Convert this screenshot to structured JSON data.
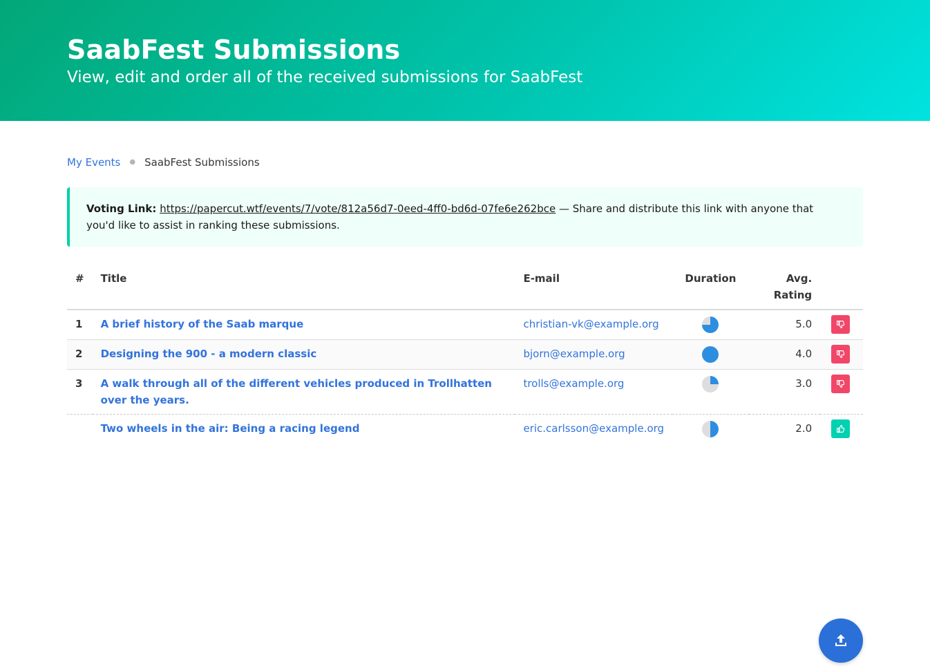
{
  "hero": {
    "title": "SaabFest Submissions",
    "subtitle": "View, edit and order all of the received submissions for SaabFest"
  },
  "breadcrumb": {
    "items": [
      {
        "label": "My Events",
        "link": true
      },
      {
        "label": "SaabFest Submissions",
        "link": false
      }
    ]
  },
  "notice": {
    "prefix": "Voting Link:",
    "url": "https://papercut.wtf/events/7/vote/812a56d7-0eed-4ff0-bd6d-07fe6e262bce",
    "suffix": " — Share and distribute this link with anyone that you'd like to assist in ranking these submissions."
  },
  "table": {
    "headers": {
      "num": "#",
      "title": "Title",
      "email": "E-mail",
      "duration": "Duration",
      "rating": "Avg. Rating"
    },
    "rows": [
      {
        "num": "1",
        "title": "A brief history of the Saab marque",
        "email": "christian-vk@example.org",
        "duration_fraction": 0.75,
        "rating": "5.0",
        "vote": "down"
      },
      {
        "num": "2",
        "title": "Designing the 900 - a modern classic",
        "email": "bjorn@example.org",
        "duration_fraction": 1.0,
        "rating": "4.0",
        "vote": "down"
      },
      {
        "num": "3",
        "title": "A walk through all of the different vehicles produced in Trollhatten over the years.",
        "email": "trolls@example.org",
        "duration_fraction": 0.25,
        "rating": "3.0",
        "vote": "down"
      },
      {
        "num": "",
        "title": "Two wheels in the air: Being a racing legend",
        "email": "eric.carlsson@example.org",
        "duration_fraction": 0.5,
        "rating": "2.0",
        "vote": "up"
      }
    ]
  },
  "icons": {
    "down_vote": "thumbs-down-icon",
    "up_vote": "thumbs-up-icon",
    "upload": "upload-icon"
  },
  "colors": {
    "link": "#3273dc",
    "downvote": "#f14668",
    "upvote": "#00d1b2",
    "pie_fill": "#2d8ee0",
    "pie_empty": "#dddddd",
    "fab": "#2b6fd8"
  }
}
